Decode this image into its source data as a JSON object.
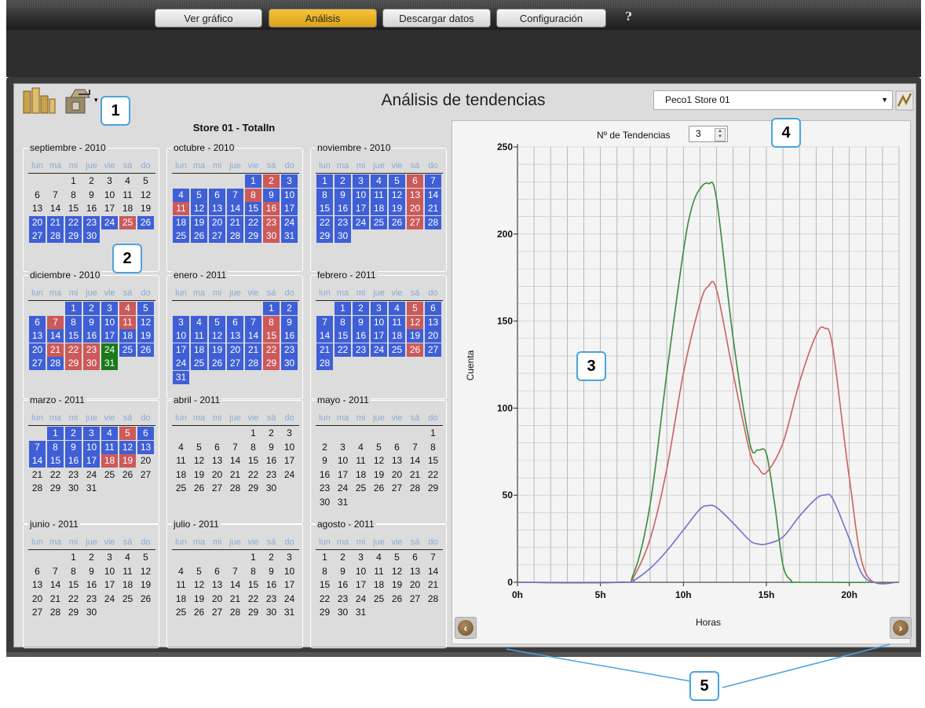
{
  "nav": {
    "tabs": [
      {
        "label": "Ver gráfico",
        "active": false
      },
      {
        "label": "Análisis",
        "active": true
      },
      {
        "label": "Descargar datos",
        "active": false
      },
      {
        "label": "Configuración",
        "active": false
      }
    ],
    "help": "?"
  },
  "header": {
    "title": "Análisis de tendencias",
    "store_select": "Peco1 Store 01"
  },
  "calendar": {
    "title": "Store 01 - TotalIn",
    "weekdays": [
      "lun",
      "ma",
      "mi",
      "jue",
      "vie",
      "sá",
      "do"
    ],
    "months": [
      {
        "name": "septiembre - 2010",
        "start": 2,
        "days": 30,
        "red": [
          25
        ],
        "green": [],
        "blue": [
          [
            20,
            30
          ]
        ]
      },
      {
        "name": "octubre - 2010",
        "start": 4,
        "days": 31,
        "red": [
          2,
          8,
          11,
          16,
          23,
          30
        ],
        "green": [],
        "blue": [
          [
            1,
            31
          ]
        ]
      },
      {
        "name": "noviembre - 2010",
        "start": 0,
        "days": 30,
        "red": [
          6,
          13,
          20,
          27
        ],
        "green": [],
        "blue": [
          [
            1,
            30
          ]
        ]
      },
      {
        "name": "diciembre - 2010",
        "start": 2,
        "days": 31,
        "red": [
          4,
          7,
          11,
          21,
          22,
          23,
          29,
          30
        ],
        "green": [
          24,
          31
        ],
        "blue": [
          [
            1,
            31
          ]
        ]
      },
      {
        "name": "enero - 2011",
        "start": 5,
        "days": 31,
        "red": [
          8,
          15,
          22,
          29
        ],
        "green": [],
        "blue": [
          [
            1,
            31
          ]
        ]
      },
      {
        "name": "febrero - 2011",
        "start": 1,
        "days": 28,
        "red": [
          5,
          12,
          26
        ],
        "green": [],
        "blue": [
          [
            1,
            28
          ]
        ]
      },
      {
        "name": "marzo - 2011",
        "start": 1,
        "days": 31,
        "red": [
          5,
          18,
          19
        ],
        "green": [],
        "blue": [
          [
            1,
            19
          ]
        ]
      },
      {
        "name": "abril - 2011",
        "start": 4,
        "days": 30,
        "red": [],
        "green": [],
        "blue": []
      },
      {
        "name": "mayo - 2011",
        "start": 6,
        "days": 31,
        "red": [],
        "green": [],
        "blue": []
      },
      {
        "name": "junio - 2011",
        "start": 2,
        "days": 30,
        "red": [],
        "green": [],
        "blue": []
      },
      {
        "name": "julio - 2011",
        "start": 4,
        "days": 31,
        "red": [],
        "green": [],
        "blue": []
      },
      {
        "name": "agosto - 2011",
        "start": 0,
        "days": 31,
        "red": [],
        "green": [],
        "blue": []
      }
    ]
  },
  "trend_control": {
    "label": "Nº de Tendencias",
    "value": "3"
  },
  "callouts": [
    "1",
    "2",
    "3",
    "4",
    "5"
  ],
  "colors": {
    "blue_day": "#3f5fd6",
    "red_day": "#cc5a5a",
    "green_day": "#1a7a1a",
    "active_tab": "#f4c23a"
  },
  "icons": [
    "bar-chart-icon",
    "export-icon",
    "chevron-down-icon",
    "pencil-icon",
    "arrow-left-icon",
    "arrow-right-icon"
  ],
  "chart_data": {
    "type": "line",
    "xlabel": "Horas",
    "ylabel": "Cuenta",
    "xlim": [
      0,
      23
    ],
    "ylim": [
      0,
      250
    ],
    "x_ticks": [
      "0h",
      "5h",
      "10h",
      "15h",
      "20h"
    ],
    "y_ticks": [
      "0",
      "50",
      "100",
      "150",
      "200",
      "250"
    ],
    "grid": true,
    "series": [
      {
        "color": "#3a8a3a",
        "x": [
          0,
          6,
          7,
          8,
          9,
          10,
          10.5,
          11,
          11.5,
          12,
          13,
          14,
          14.5,
          15,
          15.5,
          16,
          16.5,
          17,
          23
        ],
        "y": [
          0,
          0,
          5,
          45,
          120,
          190,
          215,
          226,
          229,
          220,
          140,
          80,
          76,
          74,
          45,
          10,
          1,
          0,
          0
        ]
      },
      {
        "color": "#cc6060",
        "x": [
          0,
          6.5,
          7,
          8,
          9,
          10,
          11,
          11.5,
          12,
          13,
          14,
          14.5,
          15,
          16,
          17,
          18,
          18.5,
          19,
          20,
          21,
          23
        ],
        "y": [
          0,
          0,
          3,
          25,
          65,
          120,
          160,
          170,
          168,
          120,
          75,
          66,
          63,
          80,
          115,
          142,
          146,
          135,
          60,
          5,
          0
        ]
      },
      {
        "color": "#7070cc",
        "x": [
          0,
          6.5,
          7,
          8,
          9,
          10,
          11,
          11.5,
          12,
          13,
          14,
          14.5,
          15,
          16,
          17,
          18,
          18.5,
          19,
          20,
          21,
          23
        ],
        "y": [
          0,
          0,
          1,
          8,
          18,
          30,
          42,
          44,
          43,
          34,
          24,
          22,
          22,
          26,
          38,
          48,
          50,
          48,
          25,
          2,
          0
        ]
      }
    ]
  }
}
